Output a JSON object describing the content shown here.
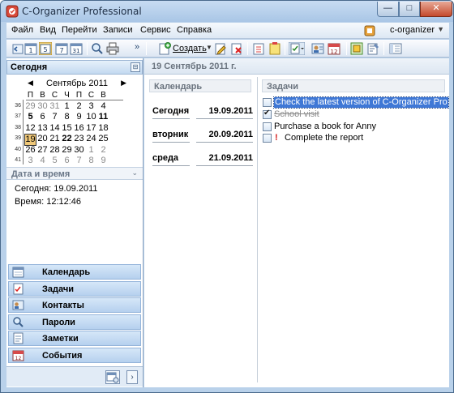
{
  "window": {
    "title": "C-Organizer Professional",
    "controls": {
      "minimize": "—",
      "maximize": "□",
      "close": "✕"
    }
  },
  "menu": {
    "items": [
      "Файл",
      "Вид",
      "Перейти",
      "Записи",
      "Сервис",
      "Справка"
    ],
    "profile": "c-organizer"
  },
  "toolbar": {
    "create_label": "Создать"
  },
  "left_panel": {
    "header": "Сегодня",
    "pin": "⊟",
    "calendar": {
      "month_label": "Сентябрь 2011",
      "dow": [
        "П",
        "В",
        "С",
        "Ч",
        "П",
        "С",
        "В"
      ],
      "weeks": [
        {
          "num": "36",
          "days": [
            "29",
            "30",
            "31",
            "1",
            "2",
            "3",
            "4"
          ]
        },
        {
          "num": "37",
          "days": [
            "5",
            "6",
            "7",
            "8",
            "9",
            "10",
            "11"
          ]
        },
        {
          "num": "38",
          "days": [
            "12",
            "13",
            "14",
            "15",
            "16",
            "17",
            "18"
          ]
        },
        {
          "num": "39",
          "days": [
            "19",
            "20",
            "21",
            "22",
            "23",
            "24",
            "25"
          ]
        },
        {
          "num": "40",
          "days": [
            "26",
            "27",
            "28",
            "29",
            "30",
            "1",
            "2"
          ]
        },
        {
          "num": "41",
          "days": [
            "3",
            "4",
            "5",
            "6",
            "7",
            "8",
            "9"
          ]
        }
      ],
      "today": "19"
    },
    "datetime": {
      "header": "Дата и время",
      "today_line": "Сегодня: 19.09.2011",
      "time_line": "Время: 12:12:46"
    },
    "nav": [
      {
        "label": "Календарь",
        "icon": "calendar-icon"
      },
      {
        "label": "Задачи",
        "icon": "tasks-icon"
      },
      {
        "label": "Контакты",
        "icon": "contacts-icon"
      },
      {
        "label": "Пароли",
        "icon": "passwords-icon"
      },
      {
        "label": "Заметки",
        "icon": "notes-icon"
      },
      {
        "label": "События",
        "icon": "events-icon"
      }
    ],
    "nav_more": "›"
  },
  "main": {
    "date_header": "19 Сентябрь 2011 г.",
    "calendar": {
      "header": "Календарь",
      "events": [
        {
          "day": "Сегодня",
          "date": "19.09.2011"
        },
        {
          "day": "вторник",
          "date": "20.09.2011"
        },
        {
          "day": "среда",
          "date": "21.09.2011"
        }
      ]
    },
    "tasks": {
      "header": "Задачи",
      "items": [
        {
          "text": "Check the latest version of C-Organizer Pro",
          "checked": false,
          "selected": true
        },
        {
          "text": "School visit",
          "checked": true,
          "done": true
        },
        {
          "text": "Purchase a book for Anny",
          "checked": false
        },
        {
          "text": "Complete the report",
          "checked": false,
          "priority": "!"
        }
      ]
    }
  },
  "colors": {
    "accent": "#3f78d6",
    "window_frame": "#b9d1ea",
    "today_highlight": "#f0c878",
    "priority": "#d41d1d"
  }
}
